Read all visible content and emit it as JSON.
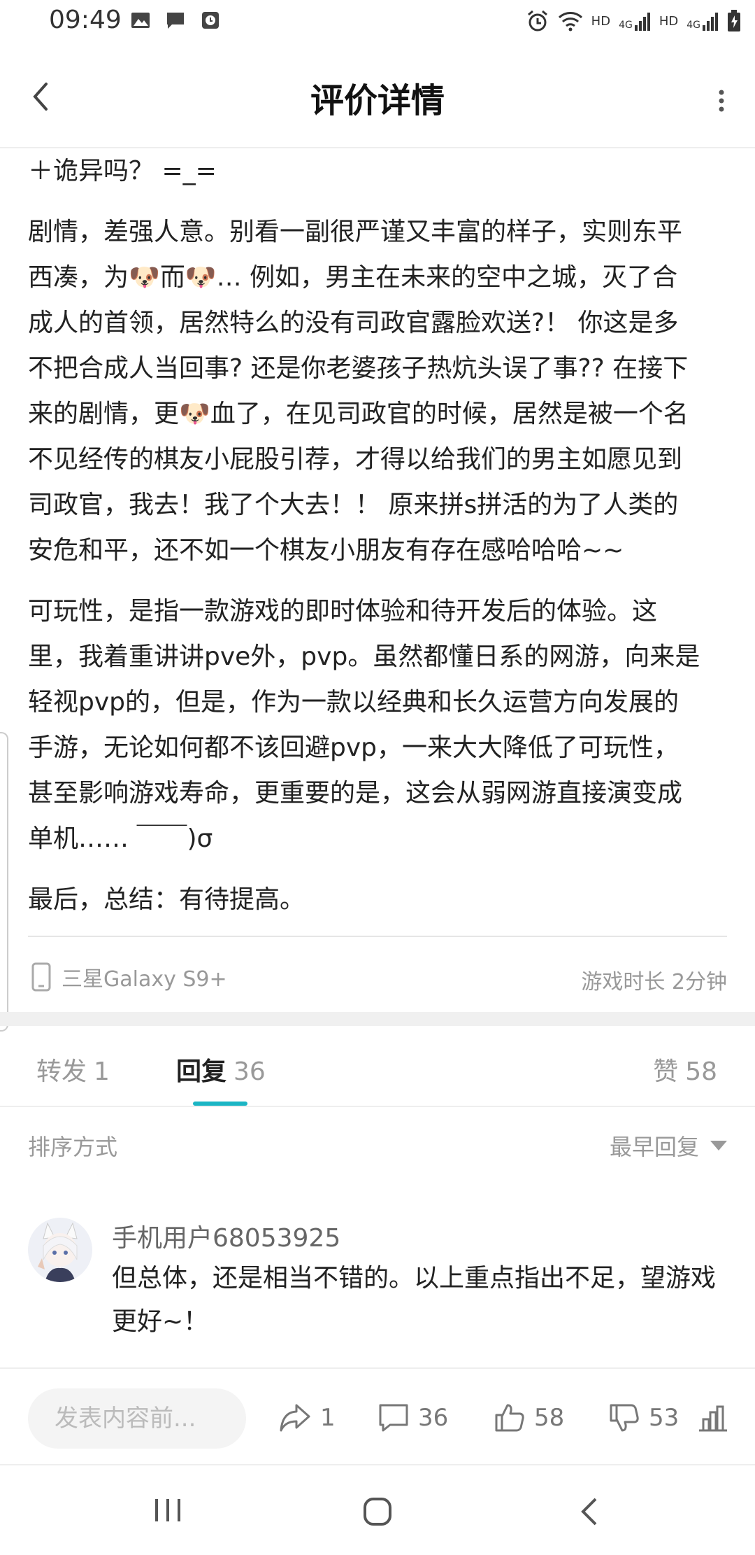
{
  "status_bar": {
    "time": "09:49",
    "network_1": "HD",
    "signal_1": "4G",
    "network_2": "HD",
    "signal_2": "4G"
  },
  "header": {
    "title": "评价详情",
    "back_icon": "back-arrow-icon",
    "more_icon": "more-vertical-icon"
  },
  "review": {
    "paragraphs": [
      "＋诡异吗？ =_=",
      "剧情，差强人意。别看一副很严谨又丰富的样子，实则东平\n西凑，为🐶而🐶… 例如，男主在未来的空中之城，灭了合\n成人的首领，居然特么的没有司政官露脸欢送?！ 你这是多\n不把合成人当回事? 还是你老婆孩子热炕头误了事?? 在接下\n来的剧情，更🐶血了，在见司政官的时候，居然是被一个名\n不见经传的棋友小屁股引荐，才得以给我们的男主如愿见到\n司政官，我去！我了个大去！！ 原来拼s拼活的为了人类的\n安危和平，还不如一个棋友小朋友有存在感哈哈哈~~",
      "可玩性，是指一款游戏的即时体验和待开发后的体验。这\n里，我着重讲讲pve外，pvp。虽然都懂日系的网游，向来是\n轻视pvp的，但是，作为一款以经典和长久运营方向发展的\n手游，无论如何都不该回避pvp，一来大大降低了可玩性，\n甚至影响游戏寿命，更重要的是，这会从弱网游直接演变成\n单机…… ￣￣)σ",
      "最后，总结：有待提高。"
    ],
    "device": "三星Galaxy S9+",
    "play_time": "游戏时长 2分钟"
  },
  "tabs": [
    {
      "label": "转发",
      "count": "1"
    },
    {
      "label": "回复",
      "count": "36"
    },
    {
      "label": "赞",
      "count": "58"
    }
  ],
  "sort": {
    "label": "排序方式",
    "value": "最早回复"
  },
  "reply": {
    "username": "手机用户68053925",
    "text": "但总体，还是相当不错的。以上重点指出不足，望游戏更好~！"
  },
  "bottom_bar": {
    "input_placeholder": "发表内容前...",
    "share_count": "1",
    "comment_count": "36",
    "like_count": "58",
    "dislike_count": "53"
  },
  "colors": {
    "accent": "#1bb5c4",
    "muted_text": "#999999"
  }
}
